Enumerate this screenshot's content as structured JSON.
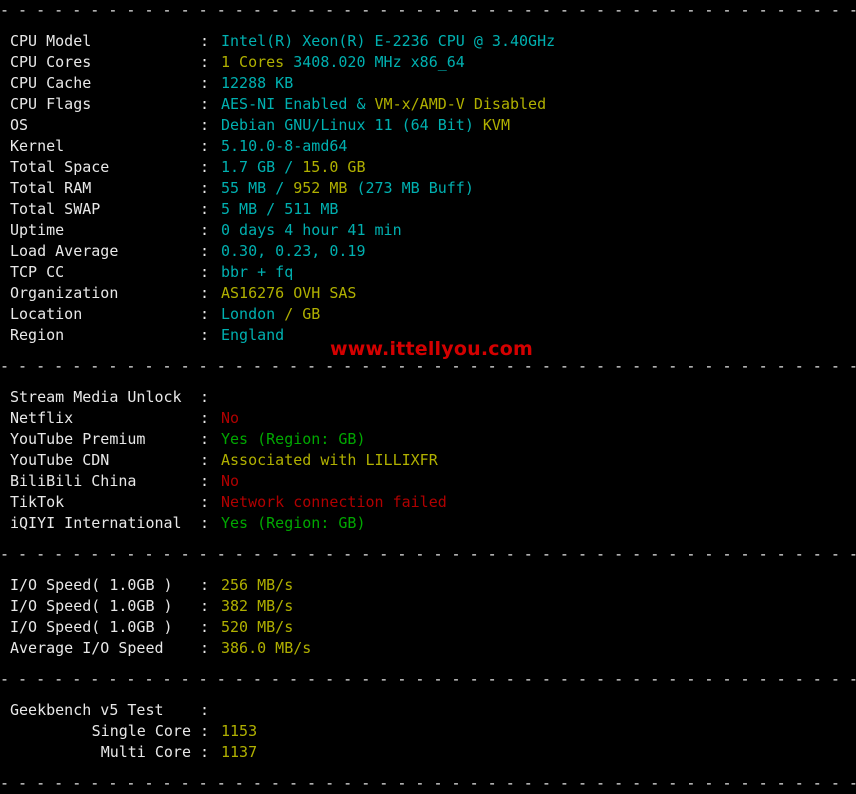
{
  "terminal": {
    "separator": "- - - - - - - - - - - - - - - - - - - - - - - - - - - - - - - - - - - - - - - - - - - - - - - - - - - - -",
    "colon": ":",
    "watermark": "www.ittellyou.com",
    "colors": {
      "background": "#000000",
      "label": "#e8e8e8",
      "cyan": "#00b0b0",
      "yellow": "#b0b000",
      "green": "#00a800",
      "red": "#b00000",
      "watermark": "#d40000"
    }
  },
  "system_info": {
    "rows": [
      {
        "label": "CPU Model",
        "parts": [
          {
            "text": "Intel(R) Xeon(R) E-2236 CPU @ 3.40GHz",
            "color": "cyan"
          }
        ]
      },
      {
        "label": "CPU Cores",
        "parts": [
          {
            "text": "1 Cores ",
            "color": "yellow"
          },
          {
            "text": "3408.020 MHz x86_64",
            "color": "cyan"
          }
        ]
      },
      {
        "label": "CPU Cache",
        "parts": [
          {
            "text": "12288 KB",
            "color": "cyan"
          }
        ]
      },
      {
        "label": "CPU Flags",
        "parts": [
          {
            "text": "AES-NI Enabled ",
            "color": "cyan"
          },
          {
            "text": "& ",
            "color": "cyan"
          },
          {
            "text": "VM-x/AMD-V Disabled",
            "color": "yellow"
          }
        ]
      },
      {
        "label": "OS",
        "parts": [
          {
            "text": "Debian GNU/Linux 11 (64 Bit) ",
            "color": "cyan"
          },
          {
            "text": "KVM",
            "color": "yellow"
          }
        ]
      },
      {
        "label": "Kernel",
        "parts": [
          {
            "text": "5.10.0-8-amd64",
            "color": "cyan"
          }
        ]
      },
      {
        "label": "Total Space",
        "parts": [
          {
            "text": "1.7 GB ",
            "color": "cyan"
          },
          {
            "text": "/ ",
            "color": "cyan"
          },
          {
            "text": "15.0 GB",
            "color": "yellow"
          }
        ]
      },
      {
        "label": "Total RAM",
        "parts": [
          {
            "text": "55 MB ",
            "color": "cyan"
          },
          {
            "text": "/ ",
            "color": "cyan"
          },
          {
            "text": "952 MB ",
            "color": "yellow"
          },
          {
            "text": "(273 MB Buff)",
            "color": "cyan"
          }
        ]
      },
      {
        "label": "Total SWAP",
        "parts": [
          {
            "text": "5 MB / 511 MB",
            "color": "cyan"
          }
        ]
      },
      {
        "label": "Uptime",
        "parts": [
          {
            "text": "0 days 4 hour 41 min",
            "color": "cyan"
          }
        ]
      },
      {
        "label": "Load Average",
        "parts": [
          {
            "text": "0.30, 0.23, 0.19",
            "color": "cyan"
          }
        ]
      },
      {
        "label": "TCP CC",
        "parts": [
          {
            "text": "bbr + fq",
            "color": "cyan"
          }
        ]
      },
      {
        "label": "Organization",
        "parts": [
          {
            "text": "AS16276 OVH SAS",
            "color": "yellow"
          }
        ]
      },
      {
        "label": "Location",
        "parts": [
          {
            "text": "London ",
            "color": "cyan"
          },
          {
            "text": "/ GB",
            "color": "yellow"
          }
        ]
      },
      {
        "label": "Region",
        "parts": [
          {
            "text": "England",
            "color": "cyan"
          }
        ]
      }
    ]
  },
  "stream_media": {
    "heading": "Stream Media Unlock",
    "rows": [
      {
        "label": "Netflix",
        "parts": [
          {
            "text": "No",
            "color": "red"
          }
        ]
      },
      {
        "label": "YouTube Premium",
        "parts": [
          {
            "text": "Yes (Region: GB)",
            "color": "green"
          }
        ]
      },
      {
        "label": "YouTube CDN",
        "parts": [
          {
            "text": "Associated with LILLIXFR",
            "color": "yellow"
          }
        ]
      },
      {
        "label": "BiliBili China",
        "parts": [
          {
            "text": "No",
            "color": "red"
          }
        ]
      },
      {
        "label": "TikTok",
        "parts": [
          {
            "text": "Network connection failed",
            "color": "red"
          }
        ]
      },
      {
        "label": "iQIYI International",
        "parts": [
          {
            "text": "Yes (Region: GB)",
            "color": "green"
          }
        ]
      }
    ]
  },
  "io_speed": {
    "rows": [
      {
        "label": "I/O Speed( 1.0GB )",
        "parts": [
          {
            "text": "256 MB/s",
            "color": "yellow"
          }
        ]
      },
      {
        "label": "I/O Speed( 1.0GB )",
        "parts": [
          {
            "text": "382 MB/s",
            "color": "yellow"
          }
        ]
      },
      {
        "label": "I/O Speed( 1.0GB )",
        "parts": [
          {
            "text": "520 MB/s",
            "color": "yellow"
          }
        ]
      },
      {
        "label": "Average I/O Speed",
        "parts": [
          {
            "text": "386.0 MB/s",
            "color": "yellow"
          }
        ]
      }
    ]
  },
  "geekbench": {
    "heading": "Geekbench v5 Test",
    "rows": [
      {
        "label": "Single Core",
        "parts": [
          {
            "text": "1153",
            "color": "yellow"
          }
        ]
      },
      {
        "label": "Multi Core",
        "parts": [
          {
            "text": "1137",
            "color": "yellow"
          }
        ]
      }
    ]
  }
}
